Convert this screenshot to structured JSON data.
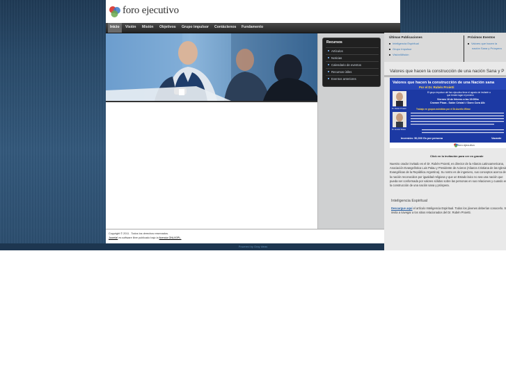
{
  "site": {
    "logo_text": "foro ejecutivo",
    "nav": [
      "Inicio",
      "Visión",
      "Misión",
      "Objetivos",
      "Grupo impulsor",
      "Contáctenos",
      "Fundamento"
    ],
    "active_nav": "Inicio"
  },
  "sidebar": {
    "title": "Recursos",
    "items": [
      "Artículos",
      "Noticias",
      "Calendario de eventos",
      "Recursos útiles",
      "Eventos anteriores"
    ]
  },
  "footer": {
    "copyright": "Copyright © 2011 . Todos los derechos reservados.",
    "joomla_link": "Joomla!",
    "joomla_text": "es software libre publicado bajo la",
    "license_link": "licencia GNU/GPL."
  },
  "powered": "Powered by Gray ideas",
  "right_panel": {
    "news_title": "Últimas Publicaciones",
    "news_items": [
      "Inteligencia Espiritual",
      "Grupo Impulsor",
      "Visión/Misión"
    ],
    "events_title": "Próximos Eventos",
    "events_items": [
      "Valores que hacen la",
      "nación Sana y Próspera"
    ],
    "headline": "Valores que hacen la construcción de una nación Sana y P",
    "flyer_title": "Valores que hacen la construcción de una Nación sana",
    "flyer_subtitle": "Por el  Dr. Rubén Proietti",
    "flyer_intro": "El grupo impulsor del foro ejecutivo tiene el agrado de invitarle a",
    "flyer_intro2": "que tendrá lugar el próximo",
    "flyer_date": "Viernes 18 de febrero a las 19:00hs",
    "flyer_place": "Crowne Plaza - Salón Cristal I / Donn Cora Alb",
    "flyer_person1": "Dr. Rubén Proietti",
    "flyer_person2": "Dr. Aurelio Wiese",
    "flyer_work": "Trabajo en grupos asistidos por el Dr.Aurelio Wiese",
    "flyer_price": "Inversión: 50,000 Gs por persona",
    "flyer_vac": "Vacante",
    "flyer_logo": "foro ejecutivo",
    "click_note": "Click en la invitación para ver en grande",
    "paragraph": "Nuestro orador invitado es el Dr. Rubén Proietti, es director de la Alianza Latinoamericana, Asociación Evangelística Luis Palau y Presidente de Acieros (Alianza Cristiana de las Iglesias Evangélicas de la República Argentina). Su rostro es de ingeniero, sus conceptos acerca de la nación reconocidos por igualdad religiosa y que un Estado laico no sea una nación que pueda ser conformada por valores sólidos sobre las personas en sus relaciones y cuando en la construcción de una nación sana y próspera.",
    "int_title": "Inteligencia Espiritual",
    "download_link": "Descargue aquí",
    "download_text": "el artículo Inteligencia Espiritual. Todos los jóvenes deberían conocerlo. Se invita a navegar a los sitios relacionados del Dr. Rubén Proietti."
  }
}
